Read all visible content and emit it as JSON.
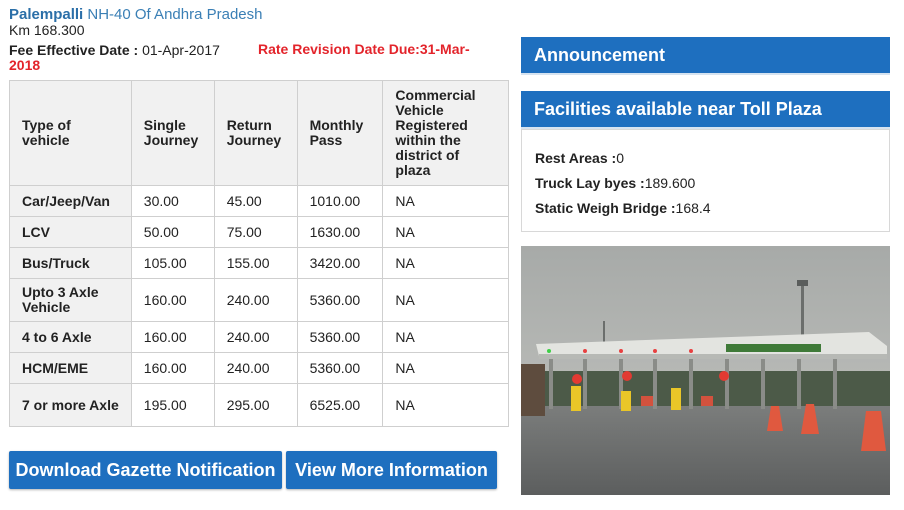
{
  "header": {
    "plaza_name": "Palempalli",
    "highway": "NH-40 Of Andhra Pradesh",
    "km": "Km 168.300"
  },
  "fee": {
    "effective_label": "Fee Effective Date :",
    "effective_date": "01-Apr-2017",
    "revision_line1": "Rate Revision Date Due:31-Mar-",
    "revision_line2": "2018"
  },
  "table": {
    "headers": [
      "Type of vehicle",
      "Single Journey",
      "Return Journey",
      "Monthly Pass",
      "Commercial Vehicle Registered within the district of plaza"
    ],
    "rows": [
      [
        "Car/Jeep/Van",
        "30.00",
        "45.00",
        "1010.00",
        "NA"
      ],
      [
        "LCV",
        "50.00",
        "75.00",
        "1630.00",
        "NA"
      ],
      [
        "Bus/Truck",
        "105.00",
        "155.00",
        "3420.00",
        "NA"
      ],
      [
        "Upto 3 Axle Vehicle",
        "160.00",
        "240.00",
        "5360.00",
        "NA"
      ],
      [
        "4 to 6 Axle",
        "160.00",
        "240.00",
        "5360.00",
        "NA"
      ],
      [
        "HCM/EME",
        "160.00",
        "240.00",
        "5360.00",
        "NA"
      ],
      [
        "7 or more Axle",
        "195.00",
        "295.00",
        "6525.00",
        "NA"
      ]
    ]
  },
  "buttons": {
    "gazette": "Download Gazette Notification",
    "more": "View More Information"
  },
  "announcement": {
    "title": "Announcement"
  },
  "facilities": {
    "title": "Facilities available near Toll Plaza",
    "items": [
      {
        "label": "Rest Areas :",
        "value": "0"
      },
      {
        "label": "Truck Lay byes :",
        "value": "189.600"
      },
      {
        "label": "Static Weigh Bridge :",
        "value": "168.4"
      }
    ]
  },
  "colors": {
    "accent": "#1e6fbf",
    "revision": "#e3242b",
    "link": "#2b6fa8"
  }
}
